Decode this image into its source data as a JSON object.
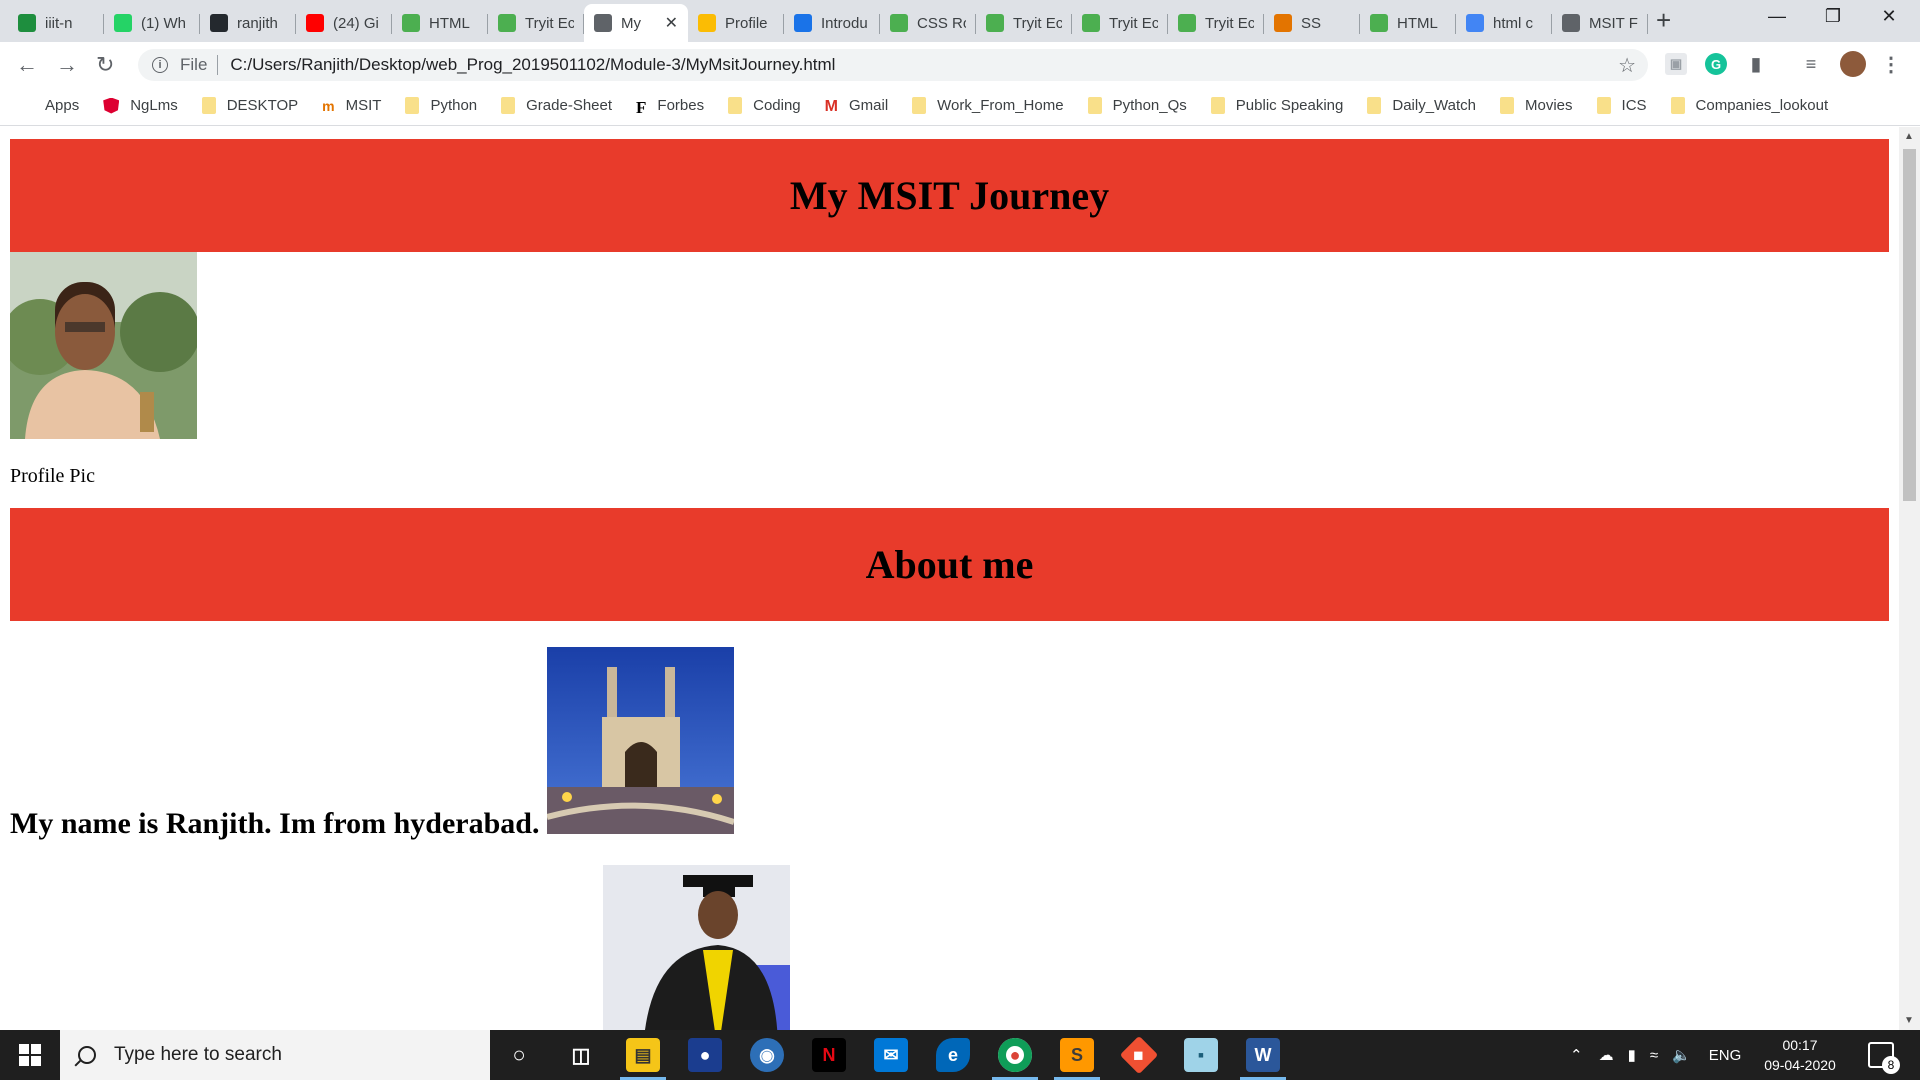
{
  "browser": {
    "tabs": [
      {
        "label": "iiit-n",
        "icon": "chart-icon",
        "color": "#1e8e3e"
      },
      {
        "label": "(1) Wh",
        "icon": "whatsapp-icon",
        "color": "#25d366"
      },
      {
        "label": "ranjith",
        "icon": "github-icon",
        "color": "#24292e"
      },
      {
        "label": "(24) Gi",
        "icon": "youtube-icon",
        "color": "#ff0000"
      },
      {
        "label": "HTML",
        "icon": "w3schools-icon",
        "color": "#4caf50"
      },
      {
        "label": "Tryit Ec",
        "icon": "w3schools-icon",
        "color": "#4caf50"
      },
      {
        "label": "My",
        "icon": "globe-icon",
        "color": "#5f6368",
        "active": true
      },
      {
        "label": "Profile",
        "icon": "drive-icon",
        "color": "#fbbc04"
      },
      {
        "label": "Introdu",
        "icon": "people-icon",
        "color": "#1a73e8"
      },
      {
        "label": "CSS Ro",
        "icon": "w3schools-icon",
        "color": "#4caf50"
      },
      {
        "label": "Tryit Ec",
        "icon": "w3schools-icon",
        "color": "#4caf50"
      },
      {
        "label": "Tryit Ec",
        "icon": "w3schools-icon",
        "color": "#4caf50"
      },
      {
        "label": "Tryit Ec",
        "icon": "w3schools-icon",
        "color": "#4caf50"
      },
      {
        "label": "SS",
        "icon": "msit-icon",
        "color": "#e37400"
      },
      {
        "label": "HTML",
        "icon": "w3schools-icon",
        "color": "#4caf50"
      },
      {
        "label": "html c",
        "icon": "google-icon",
        "color": "#4285f4"
      },
      {
        "label": "MSIT F",
        "icon": "globe-icon",
        "color": "#5f6368"
      }
    ],
    "new_tab": "+",
    "address": {
      "scheme": "File",
      "url": "C:/Users/Ranjith/Desktop/web_Prog_2019501102/Module-3/MyMsitJourney.html"
    },
    "bookmarks": [
      {
        "label": "Apps",
        "kind": "apps"
      },
      {
        "label": "NgLms",
        "kind": "angular",
        "color": "#dd0031"
      },
      {
        "label": "DESKTOP",
        "kind": "folder"
      },
      {
        "label": "MSIT",
        "kind": "msit",
        "color": "#e37400"
      },
      {
        "label": "Python",
        "kind": "folder"
      },
      {
        "label": "Grade-Sheet",
        "kind": "folder"
      },
      {
        "label": "Forbes",
        "kind": "forbes"
      },
      {
        "label": "Coding",
        "kind": "folder"
      },
      {
        "label": "Gmail",
        "kind": "gmail",
        "color": "#d93025"
      },
      {
        "label": "Work_From_Home",
        "kind": "folder"
      },
      {
        "label": "Python_Qs",
        "kind": "folder"
      },
      {
        "label": "Public Speaking",
        "kind": "folder"
      },
      {
        "label": "Daily_Watch",
        "kind": "folder"
      },
      {
        "label": "Movies",
        "kind": "folder"
      },
      {
        "label": "ICS",
        "kind": "folder"
      },
      {
        "label": "Companies_lookout",
        "kind": "folder"
      }
    ]
  },
  "page": {
    "header_title": "My MSIT Journey",
    "profile_caption": "Profile Pic",
    "about_title": "About me",
    "intro_text": "My name is Ranjith. Im from hyderabad.",
    "banner_color": "#e83b2b"
  },
  "taskbar": {
    "search_placeholder": "Type here to search",
    "language": "ENG",
    "time": "00:17",
    "date": "09-04-2020",
    "notification_count": "8"
  }
}
